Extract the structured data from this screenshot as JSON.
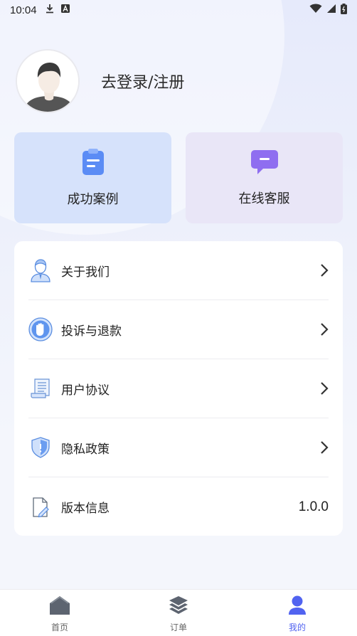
{
  "status_bar": {
    "time": "10:04"
  },
  "profile": {
    "login_text": "去登录/注册"
  },
  "quick_cards": [
    {
      "label": "成功案例",
      "icon": "clipboard-icon",
      "color": "#5b8cf5"
    },
    {
      "label": "在线客服",
      "icon": "chat-bubble-icon",
      "color": "#8f6ef0"
    }
  ],
  "menu": {
    "items": [
      {
        "label": "关于我们",
        "icon": "person-icon"
      },
      {
        "label": "投诉与退款",
        "icon": "hand-icon"
      },
      {
        "label": "用户协议",
        "icon": "document-icon"
      },
      {
        "label": "隐私政策",
        "icon": "shield-icon"
      },
      {
        "label": "版本信息",
        "icon": "file-edit-icon",
        "value": "1.0.0"
      }
    ]
  },
  "tabbar": {
    "tabs": [
      {
        "label": "首页",
        "icon": "home-icon"
      },
      {
        "label": "订单",
        "icon": "layers-icon"
      },
      {
        "label": "我的",
        "icon": "user-icon",
        "active": true
      }
    ],
    "active_color": "#5163f0"
  }
}
